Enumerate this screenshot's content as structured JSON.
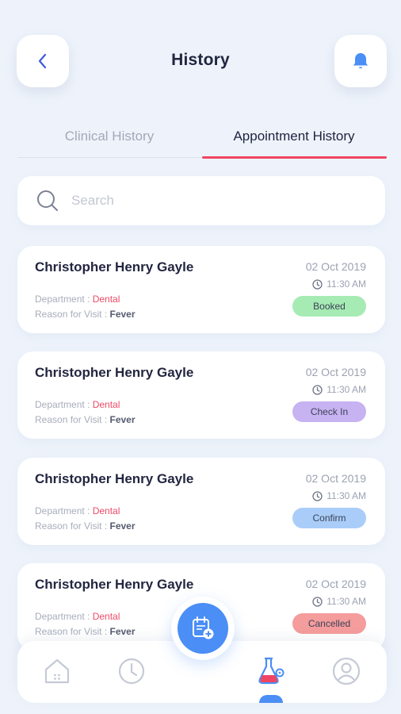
{
  "header": {
    "title": "History",
    "back_icon": "chevron-left-icon",
    "notification_icon": "bell-icon"
  },
  "tabs": [
    {
      "label": "Clinical History",
      "active": false
    },
    {
      "label": "Appointment History",
      "active": true
    }
  ],
  "search": {
    "placeholder": "Search",
    "value": ""
  },
  "appointments": [
    {
      "name": "Christopher Henry Gayle",
      "date": "02 Oct 2019",
      "time": "11:30 AM",
      "department_label": "Department : ",
      "department": "Dental",
      "reason_label": "Reason for Visit : ",
      "reason": "Fever",
      "status": "Booked",
      "status_color": "#a6ebb3"
    },
    {
      "name": "Christopher Henry Gayle",
      "date": "02 Oct 2019",
      "time": "11:30 AM",
      "department_label": "Department : ",
      "department": "Dental",
      "reason_label": "Reason for Visit : ",
      "reason": "Fever",
      "status": "Check In",
      "status_color": "#c7b2f2"
    },
    {
      "name": "Christopher Henry Gayle",
      "date": "02 Oct 2019",
      "time": "11:30 AM",
      "department_label": "Department : ",
      "department": "Dental",
      "reason_label": "Reason for Visit : ",
      "reason": "Fever",
      "status": "Confirm",
      "status_color": "#a9cdf8"
    },
    {
      "name": "Christopher Henry Gayle",
      "date": "02 Oct 2019",
      "time": "11:30 AM",
      "department_label": "Department : ",
      "department": "Dental",
      "reason_label": "Reason for Visit : ",
      "reason": "Fever",
      "status": "Cancelled",
      "status_color": "#f59c9c"
    }
  ],
  "bottom_nav": {
    "items": [
      "home-icon",
      "history-clock-icon",
      "lab-flask-icon",
      "profile-icon"
    ],
    "active": "lab-flask-icon",
    "fab_icon": "calendar-add-icon"
  },
  "colors": {
    "accent_blue": "#4a8ef6",
    "accent_red": "#ef4563",
    "background": "#eef3fb"
  }
}
